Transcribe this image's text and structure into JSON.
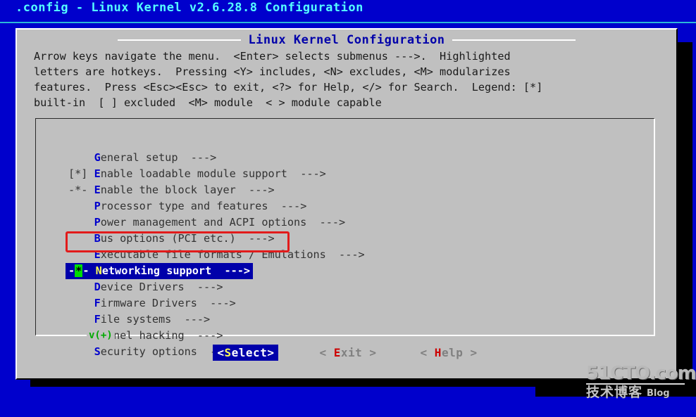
{
  "titlebar": {
    "text": ".config - Linux Kernel v2.6.28.8 Configuration"
  },
  "dialog": {
    "title": "Linux Kernel Configuration",
    "help_lines": [
      "Arrow keys navigate the menu.  <Enter> selects submenus --->.  Highlighted",
      "letters are hotkeys.  Pressing <Y> includes, <N> excludes, <M> modularizes",
      "features.  Press <Esc><Esc> to exit, <?> for Help, </> for Search.  Legend: [*]",
      "built-in  [ ] excluded  <M> module  < > module capable"
    ],
    "scroll_indicator": "v(+)"
  },
  "menu": {
    "items": [
      {
        "prefix": "    ",
        "hot": "G",
        "body": "eneral setup",
        "arrow": "  --->",
        "selected": false
      },
      {
        "prefix": "[*] ",
        "hot": "E",
        "body": "nable loadable module support",
        "arrow": "  --->",
        "selected": false
      },
      {
        "prefix": "-*- ",
        "hot": "E",
        "body": "nable the block layer",
        "arrow": "  --->",
        "selected": false
      },
      {
        "prefix": "    ",
        "hot": "P",
        "body": "rocessor type and features",
        "arrow": "  --->",
        "selected": false
      },
      {
        "prefix": "    ",
        "hot": "P",
        "body": "ower management and ACPI options",
        "arrow": "  --->",
        "selected": false
      },
      {
        "prefix": "    ",
        "hot": "B",
        "body": "us options (PCI etc.)",
        "arrow": "  --->",
        "selected": false
      },
      {
        "prefix": "    ",
        "hot": "E",
        "body": "xecutable file formats / Emulations",
        "arrow": "  --->",
        "selected": false
      },
      {
        "prefix": "-",
        "cursor": "*",
        "prefix2": "- ",
        "hot": "N",
        "body": "etworking support",
        "arrow": "  --->",
        "selected": true
      },
      {
        "prefix": "    ",
        "hot": "D",
        "body": "evice Drivers",
        "arrow": "  --->",
        "selected": false
      },
      {
        "prefix": "    ",
        "hot": "F",
        "body": "irmware Drivers",
        "arrow": "  --->",
        "selected": false
      },
      {
        "prefix": "    ",
        "hot": "F",
        "body": "ile systems",
        "arrow": "  --->",
        "selected": false
      },
      {
        "prefix": "    ",
        "hot": "K",
        "body": "ernel hacking",
        "arrow": "  --->",
        "selected": false
      },
      {
        "prefix": "    ",
        "hot": "S",
        "body": "ecurity options",
        "arrow": "  --->",
        "selected": false
      }
    ]
  },
  "buttons": [
    {
      "pre": "<",
      "hot": "S",
      "post": "elect>",
      "active": true
    },
    {
      "pre": "< ",
      "hot": "E",
      "post": "xit >",
      "active": false
    },
    {
      "pre": "< ",
      "hot": "H",
      "post": "elp >",
      "active": false
    }
  ],
  "watermark": {
    "line1": "51CTO.com",
    "line2": "技术博客",
    "line3": "Blog"
  },
  "colors": {
    "desktop_blue": "#0000cc",
    "title_cyan": "#55ffff",
    "dialog_gray": "#c0c0c0",
    "selection_navy": "#0000aa",
    "hotkey_blue": "#0000cc",
    "hotkey_yellow": "#ffff55",
    "hotkey_red": "#cc0000",
    "cursor_green": "#00dd00",
    "annotation_red": "#e21b1b",
    "scroll_green": "#00aa00"
  }
}
